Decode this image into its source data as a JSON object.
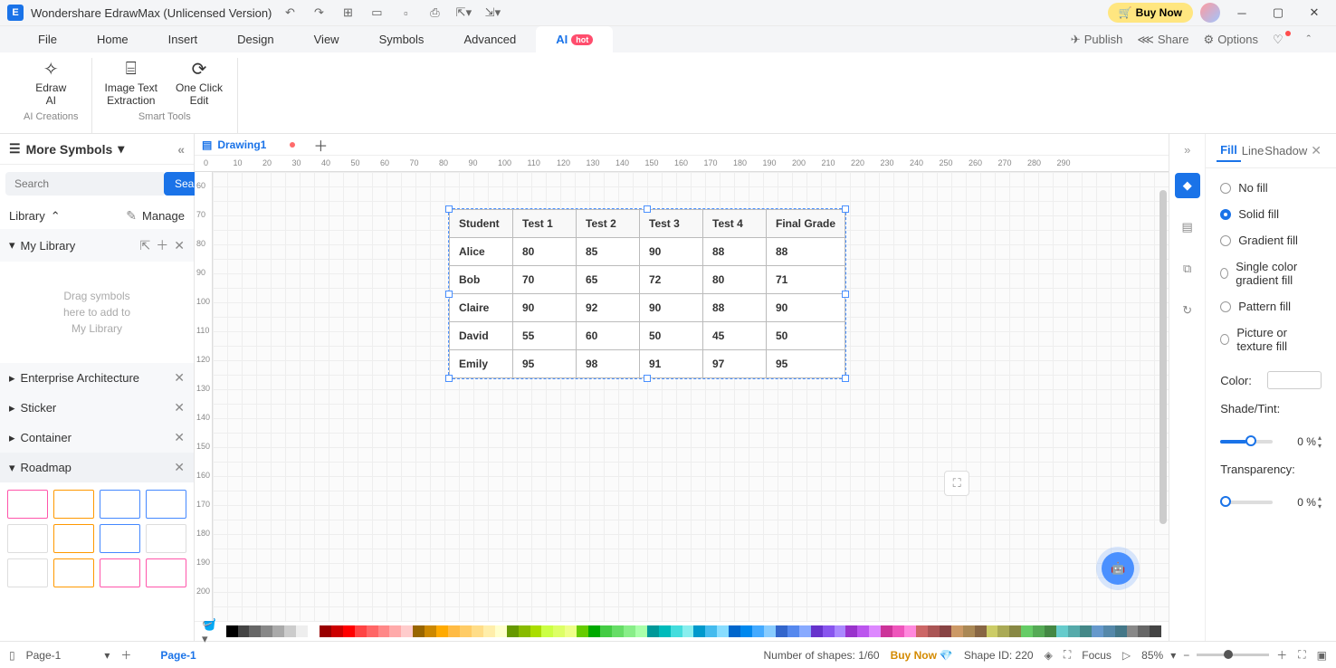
{
  "title_bar": {
    "app_title": "Wondershare EdrawMax (Unlicensed Version)",
    "buy_now": "Buy Now"
  },
  "menu": {
    "items": [
      "File",
      "Home",
      "Insert",
      "Design",
      "View",
      "Symbols",
      "Advanced"
    ],
    "active": "AI",
    "hot": "hot",
    "right": {
      "publish": "Publish",
      "share": "Share",
      "options": "Options"
    }
  },
  "ribbon": {
    "group1_title": "AI Creations",
    "group2_title": "Smart Tools",
    "edraw_ai": "Edraw\nAI",
    "image_text": "Image Text\nExtraction",
    "one_click": "One Click\nEdit"
  },
  "left_panel": {
    "more_symbols": "More Symbols",
    "search_placeholder": "Search",
    "search_btn": "Search",
    "library": "Library",
    "manage": "Manage",
    "my_library": "My Library",
    "drop_text": "Drag symbols\nhere to add to\nMy Library",
    "sections": [
      "Enterprise Architecture",
      "Sticker",
      "Container",
      "Roadmap"
    ]
  },
  "doc_tab": "Drawing1",
  "chart_data": {
    "type": "table",
    "headers": [
      "Student",
      "Test 1",
      "Test 2",
      "Test 3",
      "Test 4",
      "Final Grade"
    ],
    "rows": [
      [
        "Alice",
        "80",
        "85",
        "90",
        "88",
        "88"
      ],
      [
        "Bob",
        "70",
        "65",
        "72",
        "80",
        "71"
      ],
      [
        "Claire",
        "90",
        "92",
        "90",
        "88",
        "90"
      ],
      [
        "David",
        "55",
        "60",
        "50",
        "45",
        "50"
      ],
      [
        "Emily",
        "95",
        "98",
        "91",
        "97",
        "95"
      ]
    ]
  },
  "ruler_h": [
    "0",
    "10",
    "20",
    "30",
    "40",
    "50",
    "60",
    "70",
    "80",
    "90",
    "100",
    "110",
    "120",
    "130",
    "140",
    "150",
    "160",
    "170",
    "180",
    "190",
    "200",
    "210",
    "220",
    "230",
    "240",
    "250",
    "260",
    "270",
    "280",
    "290"
  ],
  "ruler_v": [
    "60",
    "70",
    "80",
    "90",
    "100",
    "110",
    "120",
    "130",
    "140",
    "150",
    "160",
    "170",
    "180",
    "190",
    "200"
  ],
  "right_panel": {
    "tabs": {
      "fill": "Fill",
      "line": "Line",
      "shadow": "Shadow"
    },
    "no_fill": "No fill",
    "solid_fill": "Solid fill",
    "gradient_fill": "Gradient fill",
    "single_gradient": "Single color gradient fill",
    "pattern_fill": "Pattern fill",
    "picture_fill": "Picture or texture fill",
    "color_label": "Color:",
    "shade_label": "Shade/Tint:",
    "transparency_label": "Transparency:",
    "shade_val": "0 %",
    "trans_val": "0 %"
  },
  "status": {
    "page_sel": "Page-1",
    "page_tab": "Page-1",
    "shapes_count": "Number of shapes: 1/60",
    "buy_now": "Buy Now",
    "shape_id": "Shape ID: 220",
    "focus": "Focus",
    "zoom": "85%"
  },
  "palette": [
    "#000",
    "#444",
    "#666",
    "#888",
    "#aaa",
    "#ccc",
    "#eee",
    "#fff",
    "#900",
    "#c00",
    "#f00",
    "#f44",
    "#f66",
    "#f88",
    "#faa",
    "#fcc",
    "#960",
    "#c80",
    "#fa0",
    "#fb4",
    "#fc6",
    "#fd8",
    "#fea",
    "#ffc",
    "#690",
    "#8b0",
    "#ad0",
    "#cf4",
    "#df6",
    "#ef8",
    "#6c0",
    "#0a0",
    "#4c4",
    "#6d6",
    "#8e8",
    "#afa",
    "#099",
    "#0bb",
    "#4dd",
    "#8ee",
    "#09c",
    "#4be",
    "#8df",
    "#06c",
    "#08e",
    "#4af",
    "#8cf",
    "#36c",
    "#58e",
    "#8af",
    "#63c",
    "#85e",
    "#a8f",
    "#93c",
    "#b5e",
    "#d8f",
    "#c39",
    "#e5b",
    "#f8d",
    "#c66",
    "#a55",
    "#844",
    "#c96",
    "#a85",
    "#864",
    "#cc6",
    "#aa5",
    "#884",
    "#6c6",
    "#5a5",
    "#484",
    "#6cc",
    "#5aa",
    "#488",
    "#69c",
    "#58a",
    "#478",
    "#888",
    "#666",
    "#444"
  ]
}
